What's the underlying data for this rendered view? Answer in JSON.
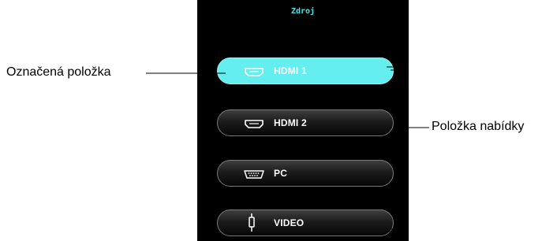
{
  "osd": {
    "title": "Zdroj",
    "items": [
      {
        "label": "HDMI 1",
        "icon": "hdmi-icon",
        "selected": true
      },
      {
        "label": "HDMI 2",
        "icon": "hdmi-icon",
        "selected": false
      },
      {
        "label": "PC",
        "icon": "vga-port-icon",
        "selected": false
      },
      {
        "label": "VIDEO",
        "icon": "rca-plug-icon",
        "selected": false
      }
    ]
  },
  "callouts": {
    "selected_item": "Označená položka",
    "menu_item": "Položka nabídky"
  },
  "colors": {
    "title": "#4ee3e8",
    "selected_fill": "#64eef0",
    "panel_background": "#000000"
  }
}
